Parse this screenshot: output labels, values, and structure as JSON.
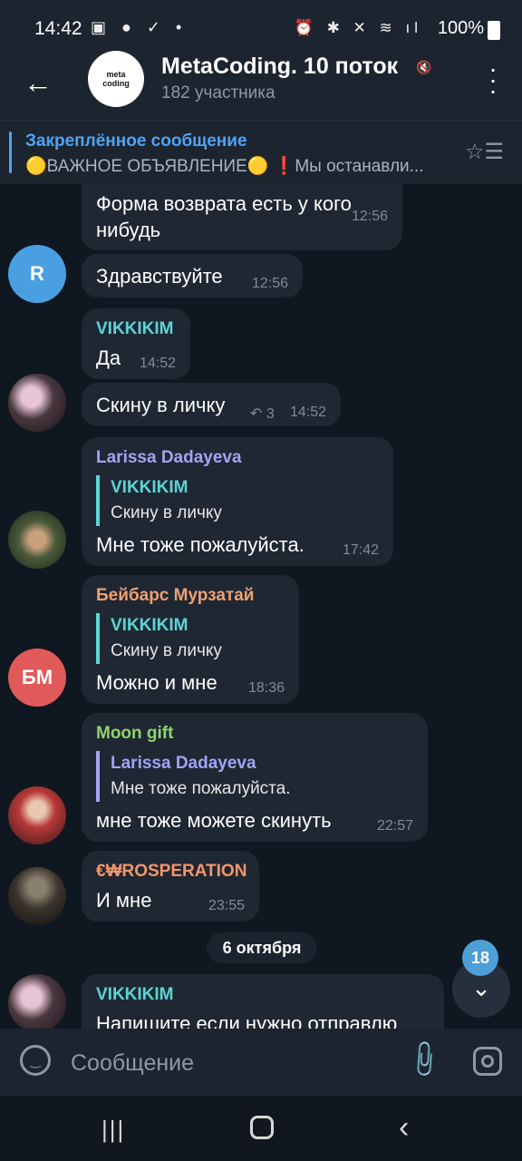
{
  "status_bar": {
    "time": "14:42",
    "battery": "100%",
    "left_icons": "▣ ● ✓ •",
    "right_icons": "⏰ ✱ ✕ ≋ ıl"
  },
  "header": {
    "title": "MetaCoding. 10 поток",
    "subtitle": "182 участника",
    "avatar_text": "meta coding"
  },
  "pinned": {
    "title": "Закреплённое сообщение",
    "text": "🟡ВАЖНОЕ ОБЪЯВЛЕНИЕ🟡 ❗️Мы останавли..."
  },
  "messages": [
    {
      "text": "Форма возврата есть у кого\nнибудь",
      "time": "12:56"
    },
    {
      "text": "Здравствуйте",
      "time": "12:56",
      "avatar_letter": "R"
    },
    {
      "sender": "VIKKIKIM",
      "text": "Да",
      "time": "14:52"
    },
    {
      "text": "Скину в личку",
      "time": "14:52",
      "replies": "3"
    },
    {
      "sender": "Larissa Dadayeva",
      "reply_name": "VIKKIKIM",
      "reply_text": "Скину в личку",
      "text": "Мне тоже пожалуйста.",
      "time": "17:42"
    },
    {
      "sender": "Бейбарс Мурзатай",
      "reply_name": "VIKKIKIM",
      "reply_text": "Скину в личку",
      "text": "Можно и мне",
      "time": "18:36",
      "avatar_letter": "БМ"
    },
    {
      "sender": "Moon gift",
      "reply_name": "Larissa Dadayeva",
      "reply_text": "Мне тоже пожалуйста.",
      "text": "мне тоже можете скинуть",
      "time": "22:57"
    },
    {
      "sender": "€₩ROSPERATION",
      "text": "И мне",
      "time": "23:55"
    },
    {
      "sender": "VIKKIKIM",
      "text": "Напишите если нужно отправлю"
    }
  ],
  "date_separator": "6 октября",
  "unread_count": "18",
  "composer": {
    "placeholder": "Сообщение"
  },
  "colors": {
    "accent": "#4ea4f6",
    "vikkikim": "#5ad6d6",
    "larissa": "#a2a4f4",
    "beibars": "#f0a070",
    "moongift": "#8fd46a",
    "rosperation": "#f5956a"
  }
}
